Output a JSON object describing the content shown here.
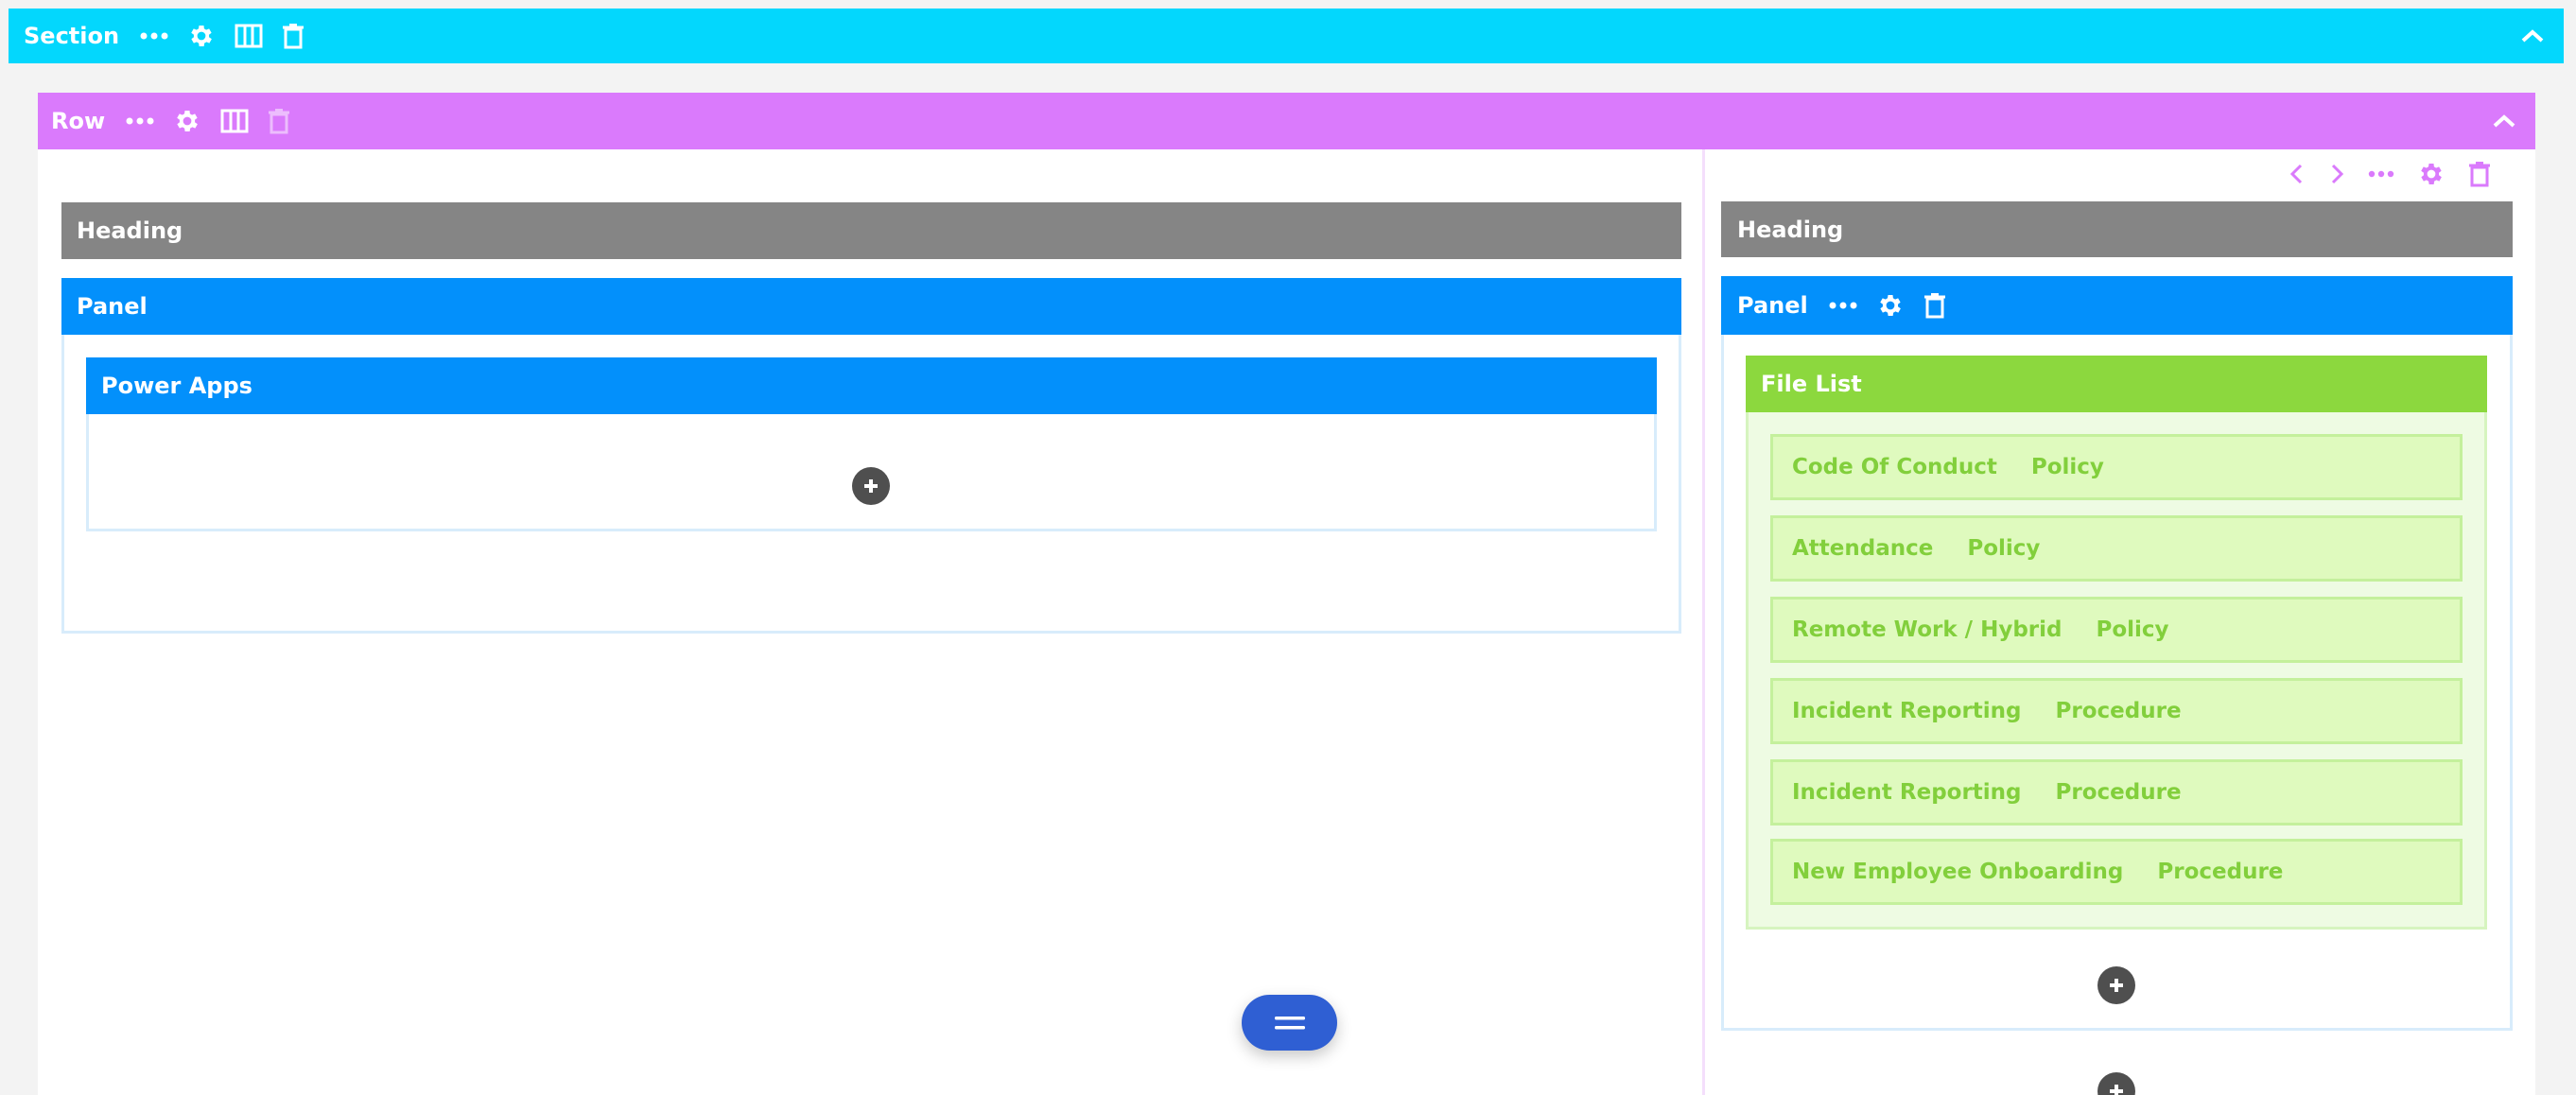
{
  "section": {
    "label": "Section"
  },
  "row": {
    "label": "Row"
  },
  "left_column": {
    "heading": "Heading",
    "panel": "Panel",
    "power_apps": "Power Apps"
  },
  "right_column": {
    "heading": "Heading",
    "panel": "Panel",
    "file_list": {
      "title": "File List",
      "items": [
        {
          "name": "Code Of Conduct",
          "type": "Policy"
        },
        {
          "name": "Attendance",
          "type": "Policy"
        },
        {
          "name": "Remote Work / Hybrid",
          "type": "Policy"
        },
        {
          "name": "Incident Reporting",
          "type": "Procedure"
        },
        {
          "name": "Incident Reporting",
          "type": "Procedure"
        },
        {
          "name": "New Employee Onboarding",
          "type": "Procedure"
        }
      ]
    }
  },
  "colors": {
    "section": "#03d7fd",
    "row": "#da7afc",
    "heading": "#858585",
    "panel": "#0390fb",
    "file_list": "#8cd83e",
    "fab": "#2f5fd3"
  }
}
